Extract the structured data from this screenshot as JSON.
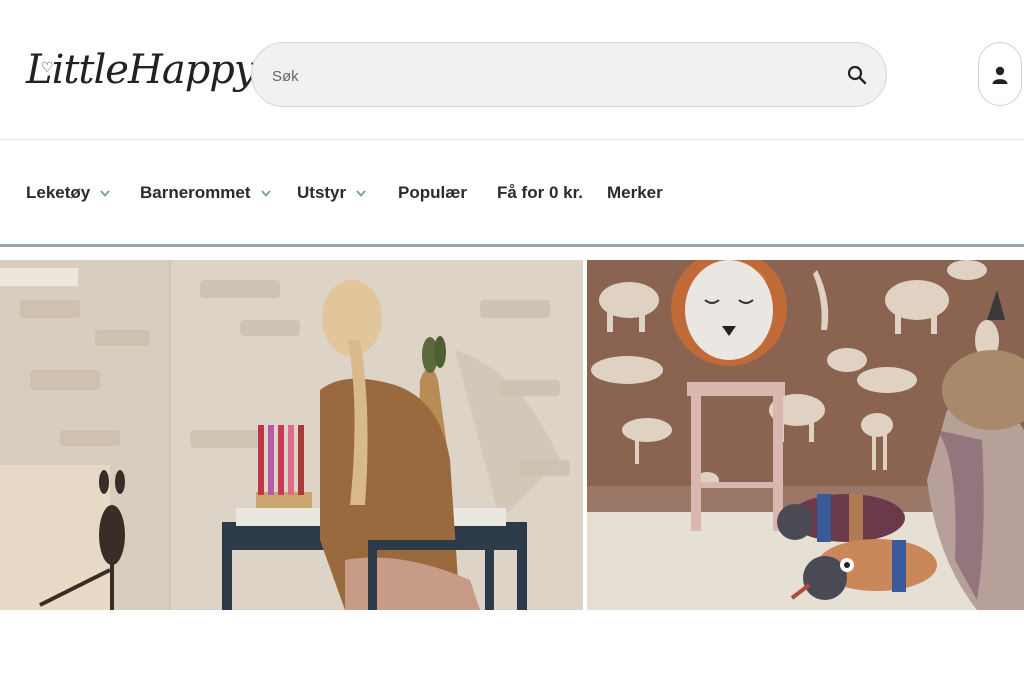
{
  "header": {
    "logo_text": "LittleHappy",
    "search": {
      "placeholder": "Søk",
      "value": ""
    }
  },
  "nav": {
    "items": [
      {
        "label": "Leketøy",
        "has_dropdown": true
      },
      {
        "label": "Barnerommet",
        "has_dropdown": true
      },
      {
        "label": "Utstyr",
        "has_dropdown": true
      },
      {
        "label": "Populær",
        "has_dropdown": false
      },
      {
        "label": "Få for 0 kr.",
        "has_dropdown": false
      },
      {
        "label": "Merker",
        "has_dropdown": false
      }
    ]
  },
  "colors": {
    "accent_line": "#8fa6b2",
    "chevron": "#7a9aa8",
    "search_bg": "#f1f1f1"
  },
  "icons": [
    "search-icon",
    "user-icon",
    "chevron-down-icon"
  ]
}
